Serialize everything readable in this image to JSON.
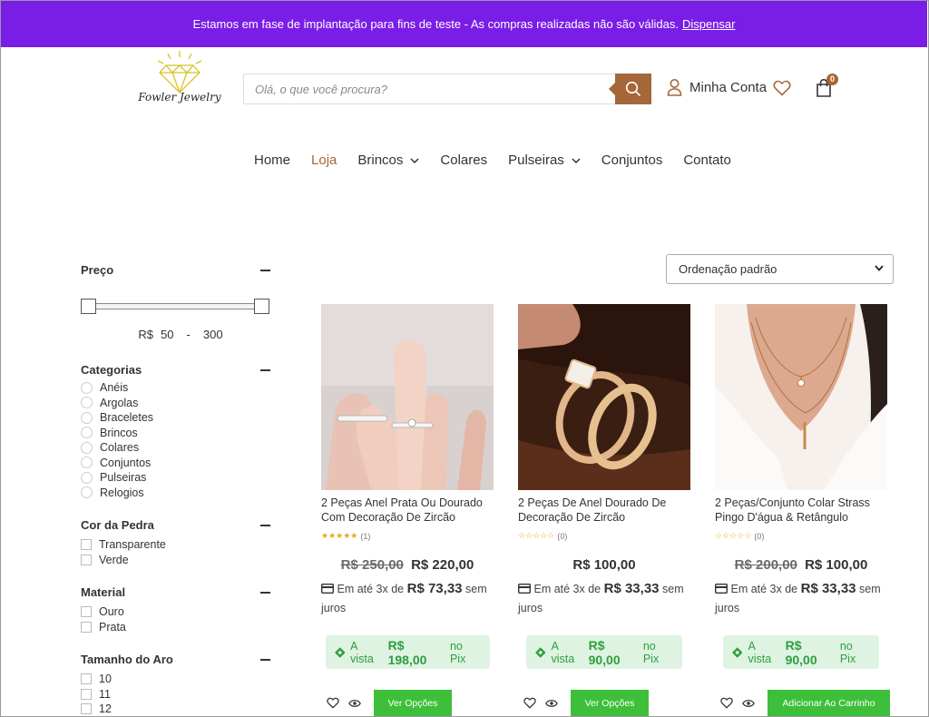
{
  "notice": {
    "text": "Estamos em fase de implantação para fins de teste - As compras realizadas não são válidas.",
    "dismiss": "Dispensar"
  },
  "brand": {
    "logo_text": "Fowler Jewelry"
  },
  "search": {
    "placeholder": "Olá, o que você procura?"
  },
  "header": {
    "account_label": "Minha Conta",
    "cart_count": "0"
  },
  "nav": {
    "items": [
      {
        "label": "Home",
        "active": false,
        "dropdown": false
      },
      {
        "label": "Loja",
        "active": true,
        "dropdown": false
      },
      {
        "label": "Brincos",
        "active": false,
        "dropdown": true
      },
      {
        "label": "Colares",
        "active": false,
        "dropdown": false
      },
      {
        "label": "Pulseiras",
        "active": false,
        "dropdown": true
      },
      {
        "label": "Conjuntos",
        "active": false,
        "dropdown": false
      },
      {
        "label": "Contato",
        "active": false,
        "dropdown": false
      }
    ]
  },
  "filters": {
    "price": {
      "title": "Preço",
      "currency": "R$",
      "min": "50",
      "sep": "-",
      "max": "300"
    },
    "categories": {
      "title": "Categorias",
      "options": [
        "Anéis",
        "Argolas",
        "Braceletes",
        "Brincos",
        "Colares",
        "Conjuntos",
        "Pulseiras",
        "Relogios"
      ]
    },
    "stone_color": {
      "title": "Cor da Pedra",
      "options": [
        "Transparente",
        "Verde"
      ]
    },
    "material": {
      "title": "Material",
      "options": [
        "Ouro",
        "Prata"
      ]
    },
    "ring_size": {
      "title": "Tamanho do Aro",
      "options": [
        "10",
        "11",
        "12"
      ]
    }
  },
  "sort": {
    "selected": "Ordenação padrão"
  },
  "products": [
    {
      "name": "2 Peças Anel Prata Ou Dourado Com Decoração De Zircão",
      "rating_count": "(1)",
      "stars_filled": 5,
      "old_price": "R$ 250,00",
      "price": "R$ 220,00",
      "inst_prefix": "Em até 3x de",
      "inst_value": "R$ 73,33",
      "inst_suffix": "sem juros",
      "pix_prefix": "A vista",
      "pix_value": "R$ 198,00",
      "pix_suffix": "no Pix",
      "button": "Ver Opções"
    },
    {
      "name": "2 Peças De Anel Dourado De Decoração De Zircão",
      "rating_count": "(0)",
      "stars_filled": 0,
      "old_price": "",
      "price": "R$ 100,00",
      "inst_prefix": "Em até 3x de",
      "inst_value": "R$ 33,33",
      "inst_suffix": "sem juros",
      "pix_prefix": "A vista",
      "pix_value": "R$ 90,00",
      "pix_suffix": "no Pix",
      "button": "Ver Opções"
    },
    {
      "name": "2 Peças/Conjunto Colar Strass Pingo D'água & Retângulo",
      "rating_count": "(0)",
      "stars_filled": 0,
      "old_price": "R$ 200,00",
      "price": "R$ 100,00",
      "inst_prefix": "Em até 3x de",
      "inst_value": "R$ 33,33",
      "inst_suffix": "sem juros",
      "pix_prefix": "A vista",
      "pix_value": "R$ 90,00",
      "pix_suffix": "no Pix",
      "button": "Adicionar Ao Carrinho"
    }
  ],
  "colors": {
    "notice_bg": "#7a1de6",
    "brand_accent": "#a5663a",
    "pix_green": "#2e9e3f",
    "button_green": "#3dbf3a"
  }
}
